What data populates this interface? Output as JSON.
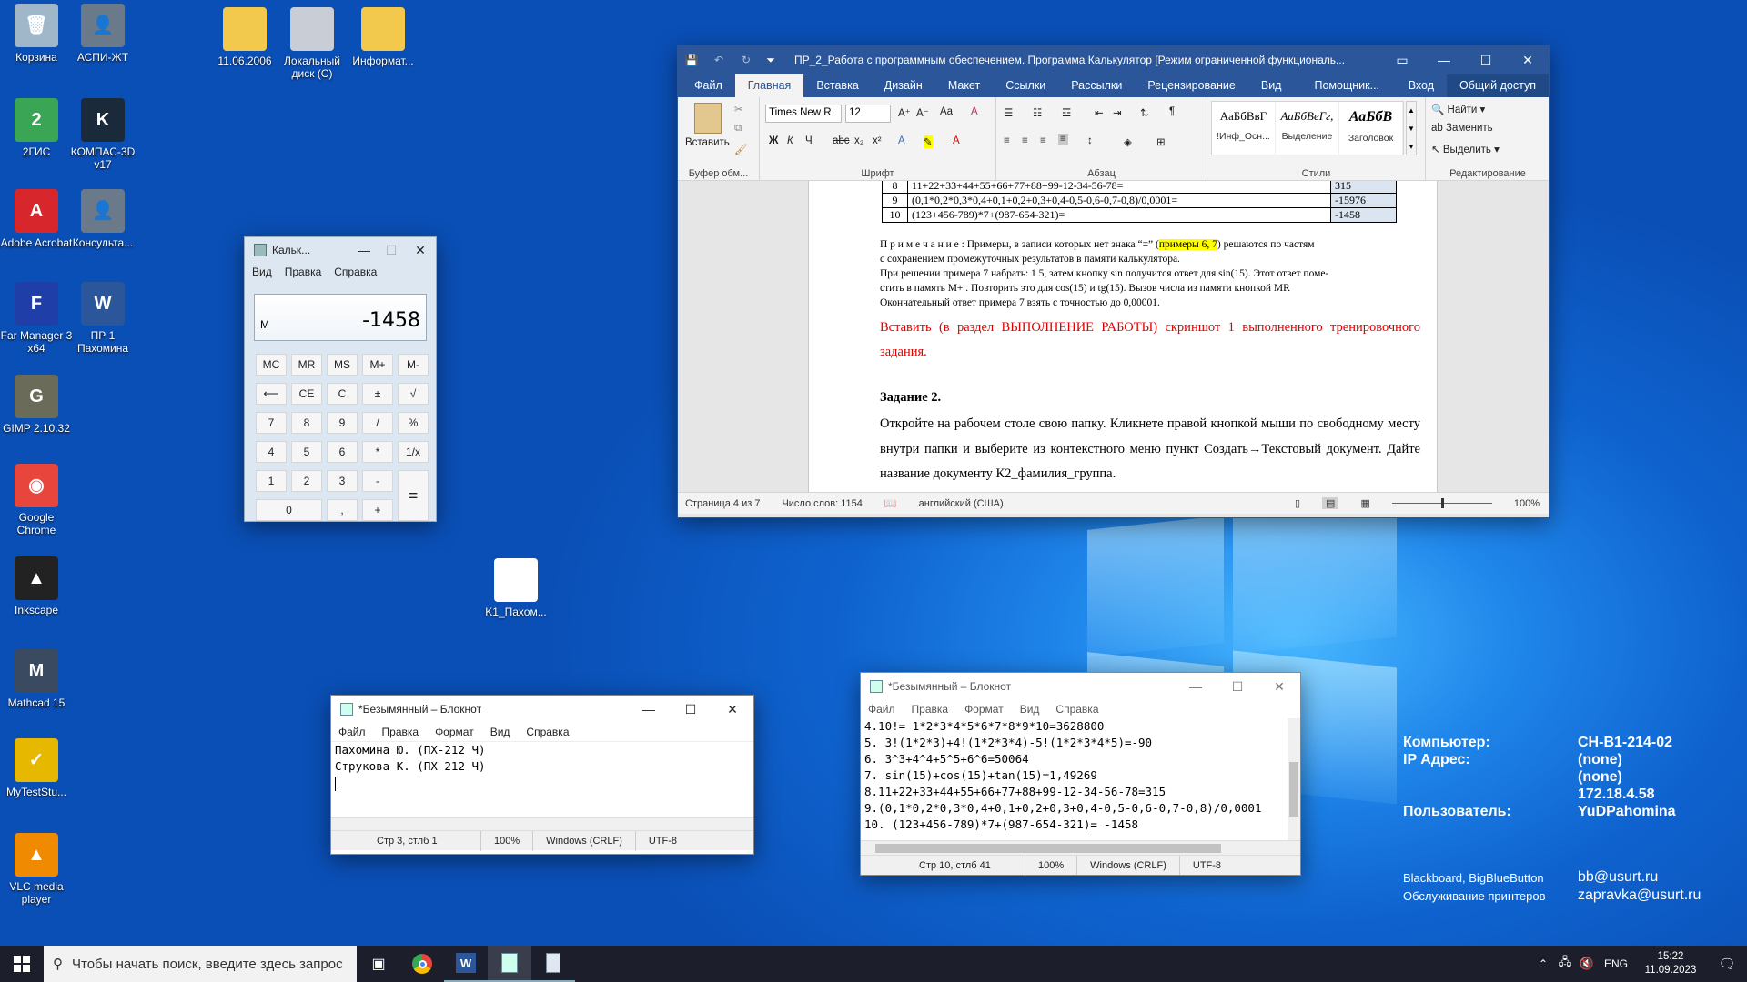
{
  "desktop_icons": [
    {
      "label": "Корзина",
      "icon": "recycle-bin-icon",
      "color": "#9fb7c9",
      "glyph": "🗑"
    },
    {
      "label": "АСПИ-ЖТ",
      "icon": "aspi-icon",
      "color": "#6a7a8a",
      "glyph": "👤"
    },
    {
      "label": "11.06.2006",
      "icon": "folder-icon",
      "color": "#f2c94c",
      "glyph": ""
    },
    {
      "label": "Локальный диск (C)",
      "icon": "drive-icon",
      "color": "#c9ced6",
      "glyph": ""
    },
    {
      "label": "Информат...",
      "icon": "folder-icon",
      "color": "#f2c94c",
      "glyph": ""
    },
    {
      "label": "2ГИС",
      "icon": "2gis-icon",
      "color": "#3aa655",
      "glyph": "2"
    },
    {
      "label": "КОМПАС-3D v17",
      "icon": "kompas-icon",
      "color": "#1b2a3a",
      "glyph": "K"
    },
    {
      "label": "Adobe Acrobat",
      "icon": "acrobat-icon",
      "color": "#d7262c",
      "glyph": "A"
    },
    {
      "label": "Консульта...",
      "icon": "consultant-icon",
      "color": "#6a7a8a",
      "glyph": "👤"
    },
    {
      "label": "Far Manager 3 x64",
      "icon": "far-manager-icon",
      "color": "#1f3ea8",
      "glyph": "F"
    },
    {
      "label": "ПР 1 Пахомина",
      "icon": "word-doc-icon",
      "color": "#2b579a",
      "glyph": "W"
    },
    {
      "label": "GIMP 2.10.32",
      "icon": "gimp-icon",
      "color": "#6b6b5a",
      "glyph": "G"
    },
    {
      "label": "Google Chrome",
      "icon": "chrome-icon",
      "color": "#e8453c",
      "glyph": "◉"
    },
    {
      "label": "Inkscape",
      "icon": "inkscape-icon",
      "color": "#222222",
      "glyph": "▲"
    },
    {
      "label": "Mathcad 15",
      "icon": "mathcad-icon",
      "color": "#3a4a60",
      "glyph": "M"
    },
    {
      "label": "MyTestStu...",
      "icon": "mytest-icon",
      "color": "#e6b800",
      "glyph": "✓"
    },
    {
      "label": "VLC media player",
      "icon": "vlc-icon",
      "color": "#f08a00",
      "glyph": "▲"
    },
    {
      "label": "K1_Пахом...",
      "icon": "text-file-icon",
      "color": "#ffffff",
      "glyph": ""
    }
  ],
  "word": {
    "title": "ПР_2_Работа с программным обеспечением. Программа Калькулятор [Режим ограниченной функциональ...",
    "tabs": [
      "Файл",
      "Главная",
      "Вставка",
      "Дизайн",
      "Макет",
      "Ссылки",
      "Рассылки",
      "Рецензирование",
      "Вид",
      "Помощник...",
      "Вход",
      "Общий доступ"
    ],
    "font_name": "Times New R",
    "font_size": "12",
    "paste_label": "Вставить",
    "groups": [
      "Буфер обм...",
      "Шрифт",
      "Абзац",
      "Стили",
      "Редактирование"
    ],
    "styles": [
      {
        "sample": "АаБбВвГ",
        "name": "!Инф_Осн..."
      },
      {
        "sample": "АаБбВеГг,",
        "name": "Выделение"
      },
      {
        "sample": "АаБбВ",
        "name": "Заголовок"
      }
    ],
    "edit": [
      "Найти",
      "Заменить",
      "Выделить"
    ],
    "table_rows": [
      {
        "n": "8",
        "expr": "11+22+33+44+55+66+77+88+99-12-34-56-78=",
        "ans": "315"
      },
      {
        "n": "9",
        "expr": "(0,1*0,2*0,3*0,4+0,1+0,2+0,3+0,4-0,5-0,6-0,7-0,8)/0,0001=",
        "ans": "-15976"
      },
      {
        "n": "10",
        "expr": "(123+456-789)*7+(987-654-321)=",
        "ans": "-1458"
      }
    ],
    "note_label": "П р и м е ч а н и е :",
    "note_1a": "Примеры, в записи которых нет знака “=” (",
    "note_1hl": "примеры 6, 7",
    "note_1b": ") решаются по частям",
    "note_2": "с сохранением промежуточных результатов в памяти калькулятора.",
    "note_3": "При решении примера 7 набрать: 1 5, затем кнопку sin получится ответ для sin(15). Этот ответ поме-",
    "note_4": "стить в память M+ . Повторить это для cos(15) и tg(15). Вызов числа из памяти кнопкой MR",
    "note_5": "Окончательный ответ примера 7 взять с точностью до 0,00001.",
    "red_text": "Вставить (в раздел ВЫПОЛНЕНИЕ РАБОТЫ) скриншот 1 выполненного тренировочного задания.",
    "task_title": "Задание 2.",
    "task_text": "Откройте на рабочем столе свою папку. Кликнете правой кнопкой мыши по свободному месту внутри папки и выберите из контекстного меню пункт Создать→Текстовый документ. Дайте название документу К2_фамилия_группа.",
    "status": {
      "page": "Страница 4 из 7",
      "words": "Число слов: 1154",
      "lang": "английский (США)",
      "zoom": "100%"
    }
  },
  "calc": {
    "title": "Кальк...",
    "menu": [
      "Вид",
      "Правка",
      "Справка"
    ],
    "mem_indicator": "M",
    "display": "-1458",
    "buttons": [
      "MC",
      "MR",
      "MS",
      "M+",
      "M-",
      "⟵",
      "CE",
      "C",
      "±",
      "√",
      "7",
      "8",
      "9",
      "/",
      "%",
      "4",
      "5",
      "6",
      "*",
      "1/x",
      "1",
      "2",
      "3",
      "-",
      "=",
      "0",
      ",",
      "+"
    ]
  },
  "notepad1": {
    "title": "*Безымянный – Блокнот",
    "menu": [
      "Файл",
      "Правка",
      "Формат",
      "Вид",
      "Справка"
    ],
    "lines": [
      "Пахомина Ю. (ПХ-212 Ч)",
      "Струкова К. (ПХ-212 Ч)"
    ],
    "status": {
      "pos": "Стр 3, стлб 1",
      "zoom": "100%",
      "eol": "Windows (CRLF)",
      "enc": "UTF-8"
    }
  },
  "notepad2": {
    "title": "*Безымянный – Блокнот",
    "menu": [
      "Файл",
      "Правка",
      "Формат",
      "Вид",
      "Справка"
    ],
    "lines": [
      "4.10!= 1*2*3*4*5*6*7*8*9*10=3628800",
      "5. 3!(1*2*3)+4!(1*2*3*4)-5!(1*2*3*4*5)=-90",
      "6. 3^3+4^4+5^5+6^6=50064",
      "7. sin(15)+cos(15)+tan(15)=1,49269",
      "8.11+22+33+44+55+66+77+88+99-12-34-56-78=315",
      "9.(0,1*0,2*0,3*0,4+0,1+0,2+0,3+0,4-0,5-0,6-0,7-0,8)/0,0001",
      "10. (123+456-789)*7+(987-654-321)= -1458"
    ],
    "status": {
      "pos": "Стр 10, стлб 41",
      "zoom": "100%",
      "eol": "Windows (CRLF)",
      "enc": "UTF-8"
    }
  },
  "info": {
    "rows": [
      {
        "k": "Компьютер:",
        "v": "CH-B1-214-02"
      },
      {
        "k": "IP Адрес:",
        "v": "(none)"
      },
      {
        "k": "",
        "v": "(none)"
      },
      {
        "k": "",
        "v": "172.18.4.58"
      },
      {
        "k": "Пользователь:",
        "v": "YuDPahomina"
      }
    ],
    "svc": [
      {
        "k": "Blackboard, BigBlueButton",
        "v": "bb@usurt.ru"
      },
      {
        "k": "Обслуживание принтеров",
        "v": "zapravka@usurt.ru"
      }
    ]
  },
  "taskbar": {
    "search": "Чтобы начать поиск, введите здесь запрос",
    "lang": "ENG",
    "time": "15:22",
    "date": "11.09.2023"
  }
}
